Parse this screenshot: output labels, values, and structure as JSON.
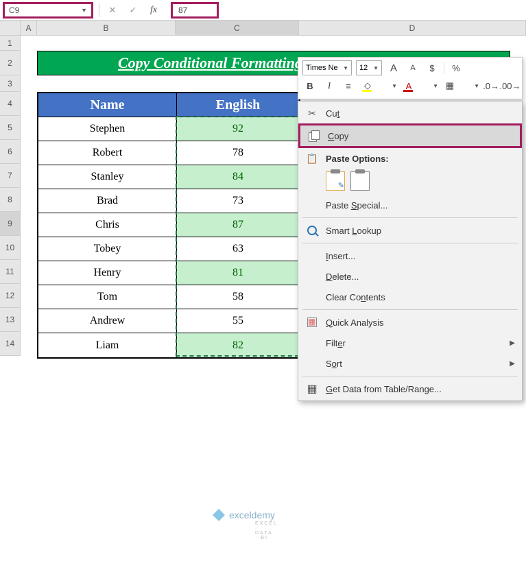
{
  "formula_bar": {
    "cell_ref": "C9",
    "formula_value": "87"
  },
  "columns": {
    "A": "A",
    "B": "B",
    "C": "C",
    "D": "D"
  },
  "rows": [
    "1",
    "2",
    "3",
    "4",
    "5",
    "6",
    "7",
    "8",
    "9",
    "10",
    "11",
    "12",
    "13",
    "14"
  ],
  "title": "Copy Conditional Formatting Using Paste Special",
  "table": {
    "headers": {
      "name": "Name",
      "english": "English"
    },
    "rows": [
      {
        "name": "Stephen",
        "english": "92",
        "highlight": true
      },
      {
        "name": "Robert",
        "english": "78",
        "highlight": false
      },
      {
        "name": "Stanley",
        "english": "84",
        "highlight": true
      },
      {
        "name": "Brad",
        "english": "73",
        "highlight": false
      },
      {
        "name": "Chris",
        "english": "87",
        "highlight": true
      },
      {
        "name": "Tobey",
        "english": "63",
        "highlight": false
      },
      {
        "name": "Henry",
        "english": "81",
        "highlight": true
      },
      {
        "name": "Tom",
        "english": "58",
        "highlight": false
      },
      {
        "name": "Andrew",
        "english": "55",
        "highlight": false
      },
      {
        "name": "Liam",
        "english": "82",
        "highlight": true
      }
    ]
  },
  "mini_toolbar": {
    "font": "Times Ne",
    "size": "12",
    "big_a": "A",
    "small_a": "A",
    "dollar": "$",
    "percent": "%",
    "bold": "B",
    "italic": "I",
    "font_a": "A",
    "decimals_inc": ".0",
    "decimals_dec": ".00"
  },
  "context_menu": {
    "cut": "Cut",
    "copy": "Copy",
    "paste_options": "Paste Options:",
    "paste_special": "Paste Special...",
    "smart_lookup": "Smart Lookup",
    "insert": "Insert...",
    "delete": "Delete...",
    "clear_contents": "Clear Contents",
    "quick_analysis": "Quick Analysis",
    "filter": "Filter",
    "sort": "Sort",
    "get_data": "Get Data from Table/Range..."
  },
  "watermark": {
    "text": "exceldemy",
    "sub": "EXCEL · DATA · BI"
  },
  "chart_data": {
    "type": "table",
    "title": "Copy Conditional Formatting Using Paste Special",
    "columns": [
      "Name",
      "English"
    ],
    "rows": [
      [
        "Stephen",
        92
      ],
      [
        "Robert",
        78
      ],
      [
        "Stanley",
        84
      ],
      [
        "Brad",
        73
      ],
      [
        "Chris",
        87
      ],
      [
        "Tobey",
        63
      ],
      [
        "Henry",
        81
      ],
      [
        "Tom",
        58
      ],
      [
        "Andrew",
        55
      ],
      [
        "Liam",
        82
      ]
    ],
    "conditional_format": {
      "column": "English",
      "rule": ">=80",
      "fill": "#c6efce",
      "text": "#006100"
    }
  }
}
